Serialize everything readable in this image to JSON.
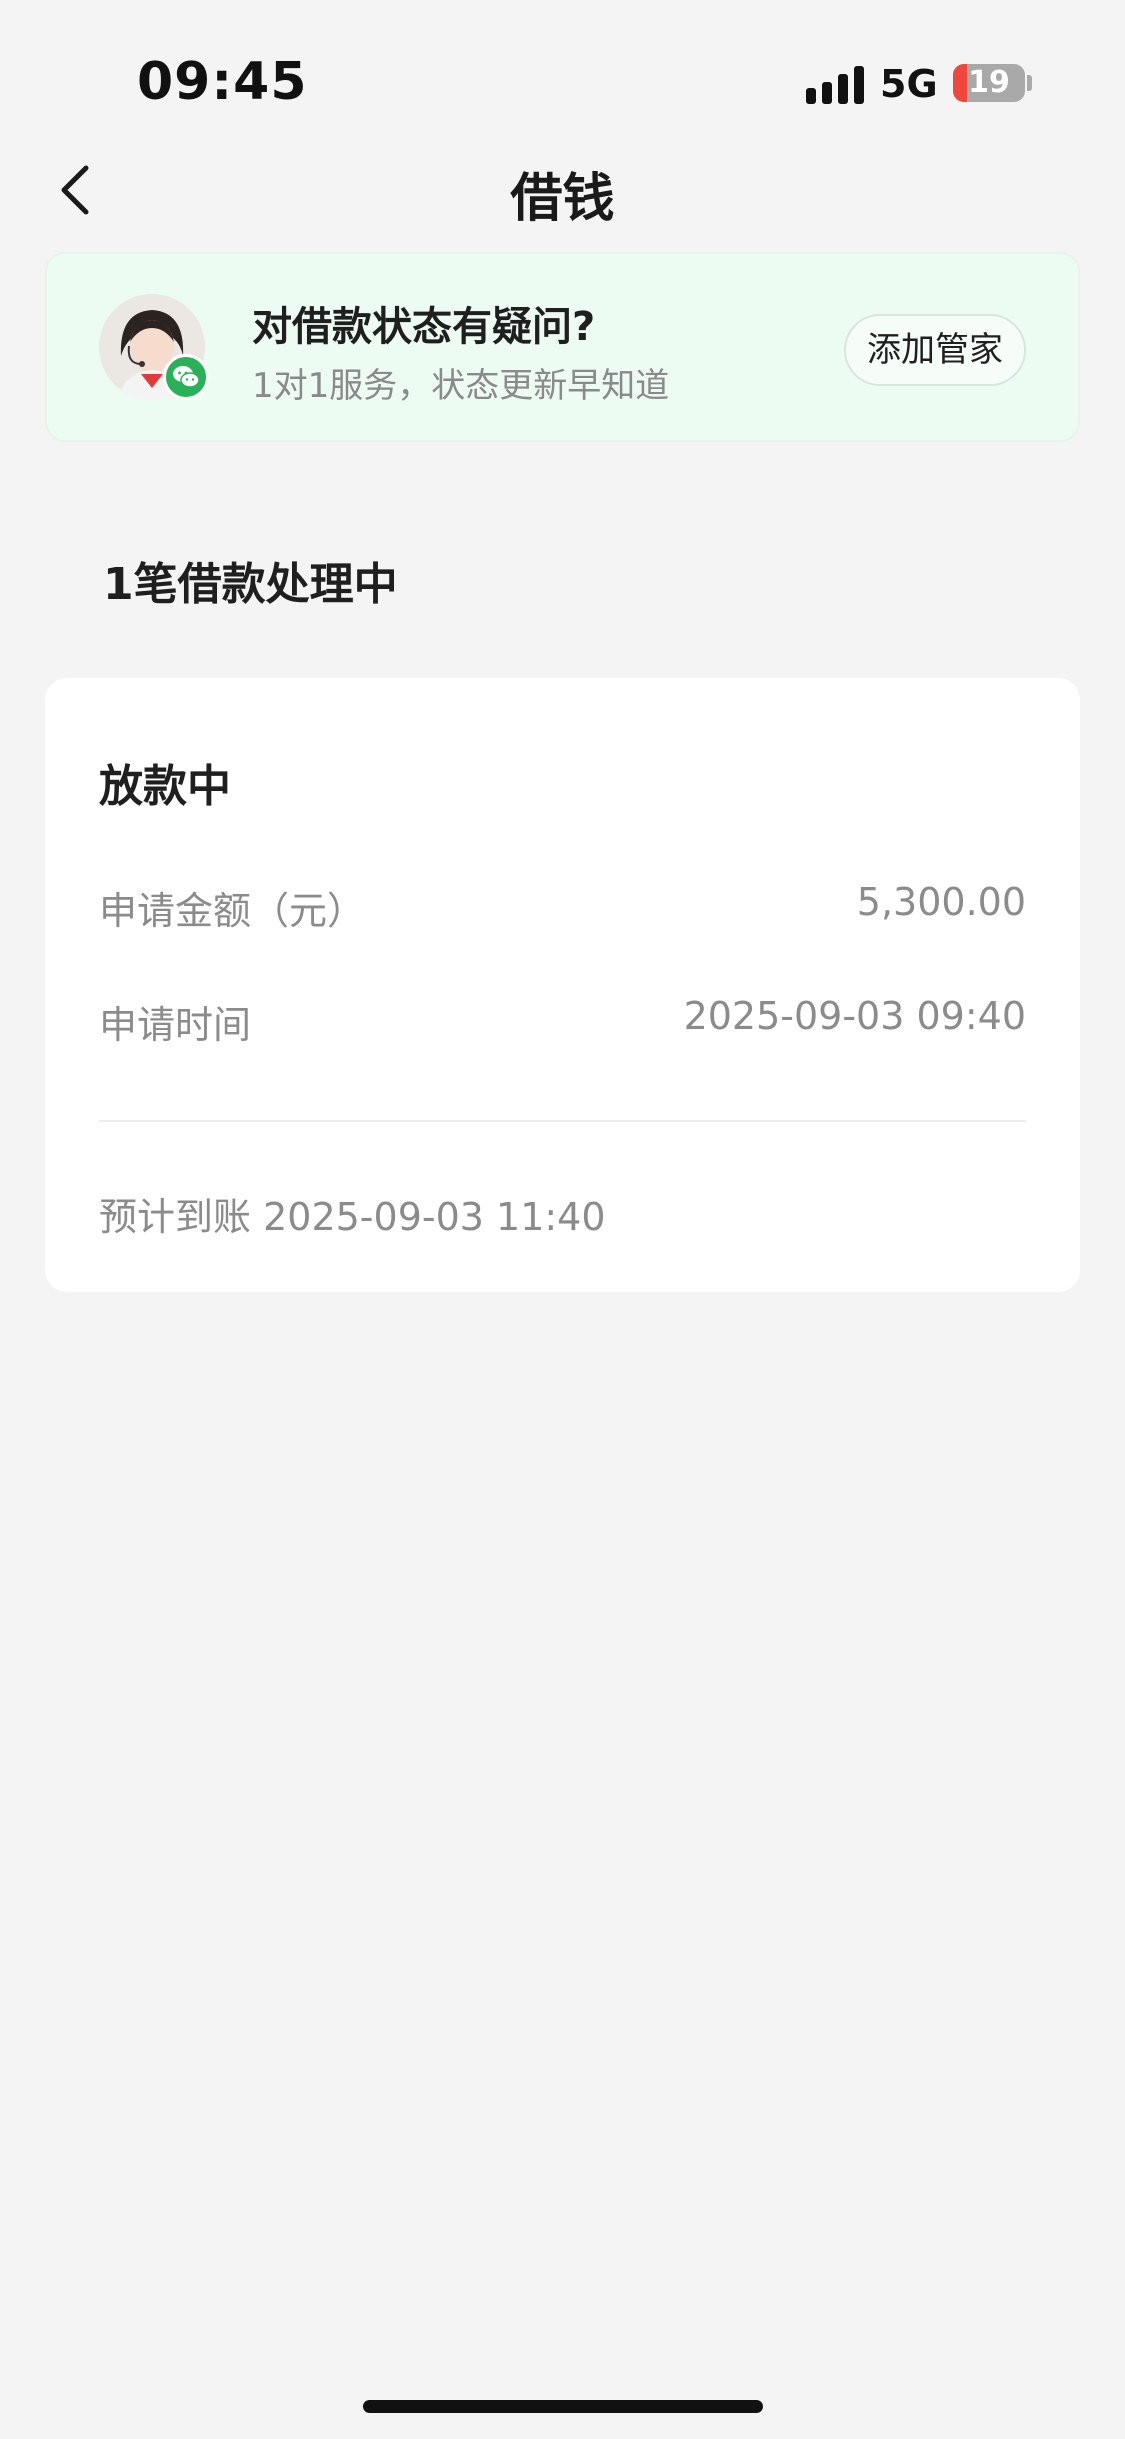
{
  "status_bar": {
    "time": "09:45",
    "network": "5G",
    "battery_level": "19",
    "battery_fraction": 0.19,
    "icons": [
      "signal-icon",
      "battery-icon"
    ]
  },
  "nav": {
    "back_icon": "chevron-left-icon",
    "title": "借钱"
  },
  "service_banner": {
    "avatar_icon": "customer-service-avatar",
    "badge_icon": "wechat-icon",
    "title": "对借款状态有疑问?",
    "subtitle": "1对1服务，状态更新早知道",
    "button_label": "添加管家"
  },
  "section": {
    "heading": "1笔借款处理中"
  },
  "loan_card": {
    "status": "放款中",
    "rows": [
      {
        "label": "申请金额（元）",
        "value": "5,300.00"
      },
      {
        "label": "申请时间",
        "value": "2025-09-03 09:40"
      }
    ],
    "arrival_label": "预计到账",
    "arrival_time": "2025-09-03 11:40"
  },
  "colors": {
    "page_background": "#f4f4f4",
    "banner_background": "#edfcf3",
    "wechat_green": "#2bb05a",
    "battery_low": "#f0463c",
    "muted_text": "#8b8b8b"
  }
}
